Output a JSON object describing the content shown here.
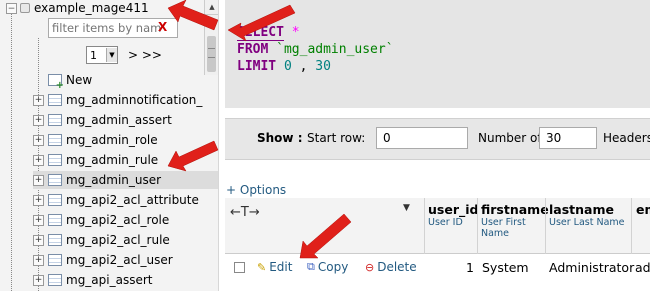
{
  "nav": {
    "database": "example_mage411",
    "filter_placeholder": "filter items by name",
    "filter_clear": "X",
    "page_value": "1",
    "page_next": "> >>",
    "new_label": "New",
    "tables": [
      "mg_adminnotification_",
      "mg_admin_assert",
      "mg_admin_role",
      "mg_admin_rule",
      "mg_admin_user",
      "mg_api2_acl_attribute",
      "mg_api2_acl_role",
      "mg_api2_acl_rule",
      "mg_api2_acl_user",
      "mg_api_assert"
    ],
    "highlighted_index": 4
  },
  "sql": {
    "line1_kw": "SELECT",
    "line1_rest": "*",
    "line2_kw": "FROM",
    "line2_rest": "`mg_admin_user`",
    "line3_kw": "LIMIT",
    "line3_a": "0",
    "line3_sep": ",",
    "line3_b": "30"
  },
  "navbar": {
    "show_label": "Show :",
    "start_row_label": "Start row:",
    "start_row_value": "0",
    "num_rows_label": "Number of rows:",
    "num_rows_value": "30",
    "headers_label": "Headers"
  },
  "results": {
    "options_link": "+ Options",
    "arrows": "←T→",
    "columns": [
      {
        "name": "user_id",
        "comment": "User ID"
      },
      {
        "name": "firstname",
        "comment": "User First Name"
      },
      {
        "name": "lastname",
        "comment": "User Last Name"
      },
      {
        "name": "em",
        "comment": ""
      }
    ],
    "actions": {
      "edit": "Edit",
      "copy": "Copy",
      "delete": "Delete"
    },
    "row": {
      "user_id": "1",
      "firstname": "System",
      "lastname": "Administrator",
      "email_partial": "adr"
    }
  },
  "colors": {
    "arrow": "#e0201a",
    "link": "#235a81",
    "keyword": "#800080",
    "identifier": "#008000"
  }
}
